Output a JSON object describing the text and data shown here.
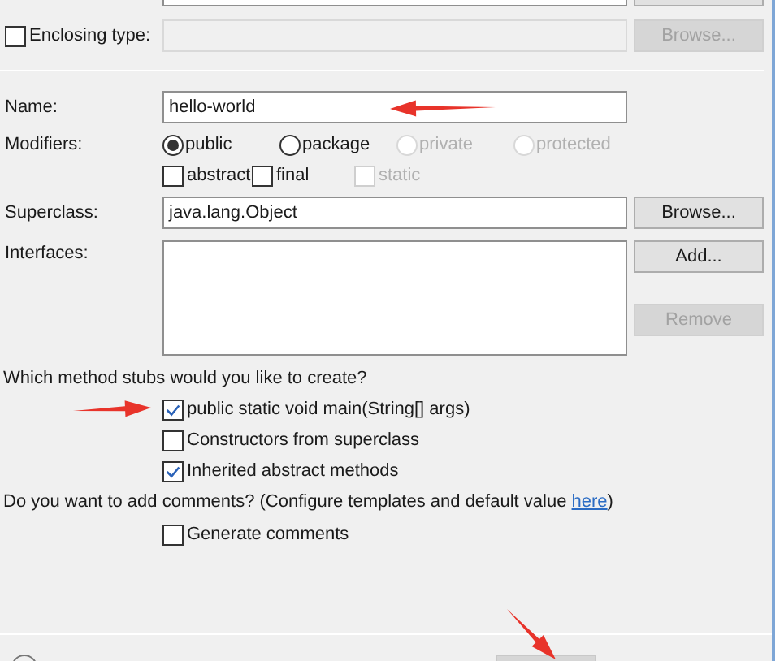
{
  "enclosing_type": {
    "label": "Enclosing type:",
    "checked": false,
    "button": "Browse...",
    "disabled": true
  },
  "name": {
    "label": "Name:",
    "value": "hello-world"
  },
  "modifiers": {
    "label": "Modifiers:",
    "access": [
      {
        "label": "public",
        "selected": true,
        "disabled": false
      },
      {
        "label": "package",
        "selected": false,
        "disabled": false
      },
      {
        "label": "private",
        "selected": false,
        "disabled": true
      },
      {
        "label": "protected",
        "selected": false,
        "disabled": true
      }
    ],
    "flags": [
      {
        "label": "abstract",
        "checked": false,
        "disabled": false
      },
      {
        "label": "final",
        "checked": false,
        "disabled": false
      },
      {
        "label": "static",
        "checked": false,
        "disabled": true
      }
    ]
  },
  "superclass": {
    "label": "Superclass:",
    "value": "java.lang.Object",
    "button": "Browse..."
  },
  "interfaces": {
    "label": "Interfaces:",
    "buttons": [
      {
        "label": "Add...",
        "disabled": false
      },
      {
        "label": "Remove",
        "disabled": true
      }
    ]
  },
  "method_stubs": {
    "question": "Which method stubs would you like to create?",
    "options": [
      {
        "label": "public static void main(String[] args)",
        "checked": true
      },
      {
        "label": "Constructors from superclass",
        "checked": false
      },
      {
        "label": "Inherited abstract methods",
        "checked": true
      }
    ]
  },
  "comments": {
    "question": "Do you want to add comments? (Configure templates and default value ",
    "link": "here",
    "question_end": ")",
    "options": [
      {
        "label": "Generate comments",
        "checked": false
      }
    ]
  }
}
